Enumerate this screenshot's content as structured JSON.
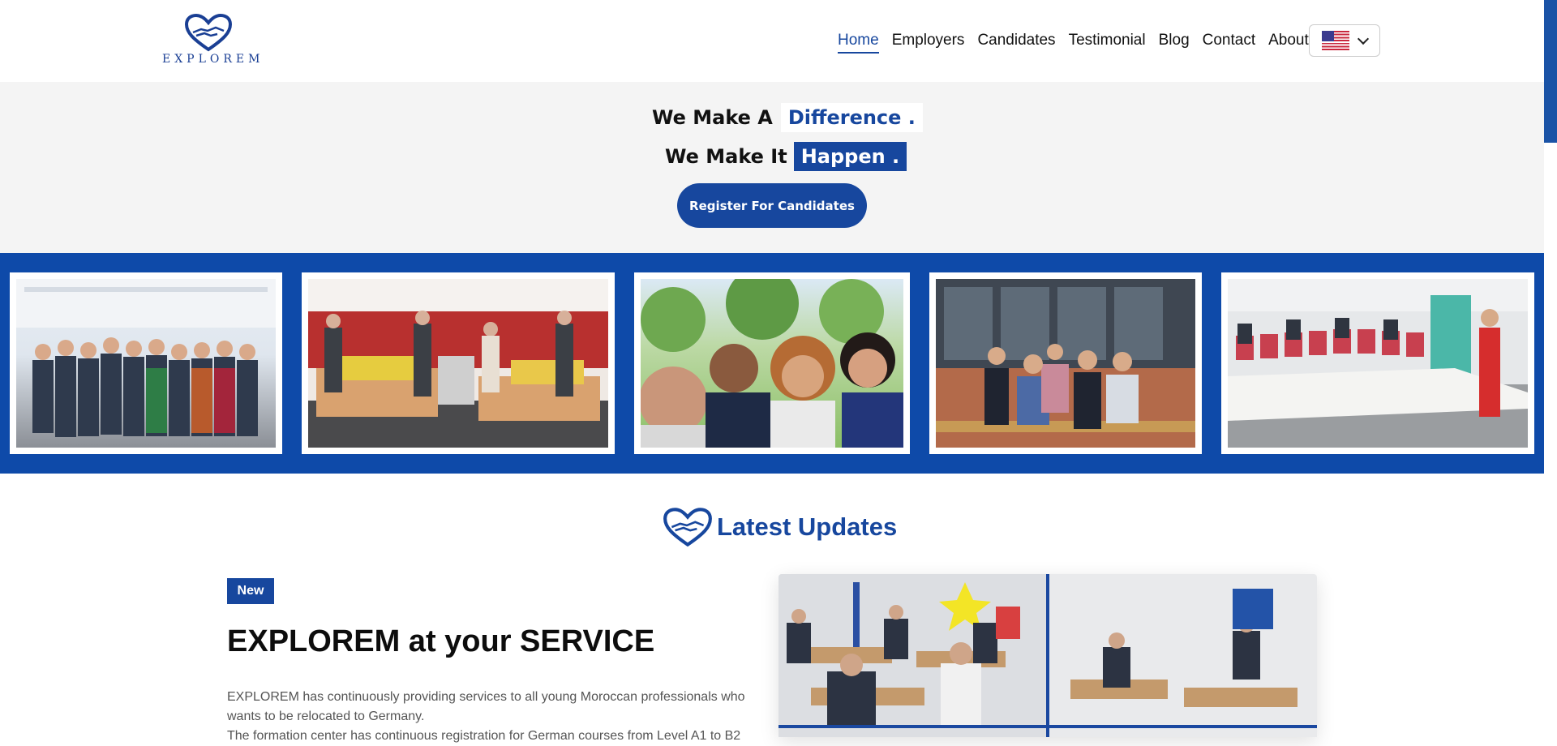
{
  "brand": {
    "name": "EXPLOREM"
  },
  "nav": {
    "items": [
      {
        "label": "Home",
        "active": true
      },
      {
        "label": "Employers"
      },
      {
        "label": "Candidates"
      },
      {
        "label": "Testimonial"
      },
      {
        "label": "Blog"
      },
      {
        "label": "Contact"
      },
      {
        "label": "About"
      }
    ],
    "language_icon": "us-flag-icon"
  },
  "hero": {
    "line1_prefix": "We Make A",
    "line1_highlight": "Difference .",
    "line2_prefix": "We Make It",
    "line2_highlight": "Happen .",
    "cta_label": "Register For Candidates"
  },
  "colors": {
    "brand_blue": "#17479e",
    "gallery_blue": "#0e4aa9",
    "hero_bg": "#f4f4f4"
  },
  "updates": {
    "heading": "Latest Updates",
    "badge": "New",
    "title": "EXPLOREM at your SERVICE",
    "paragraph1": "EXPLOREM has continuously providing services to all young Moroccan professionals who wants to be relocated to Germany.",
    "paragraph2": "The formation center has continuous registration for German courses from Level A1 to B2"
  }
}
